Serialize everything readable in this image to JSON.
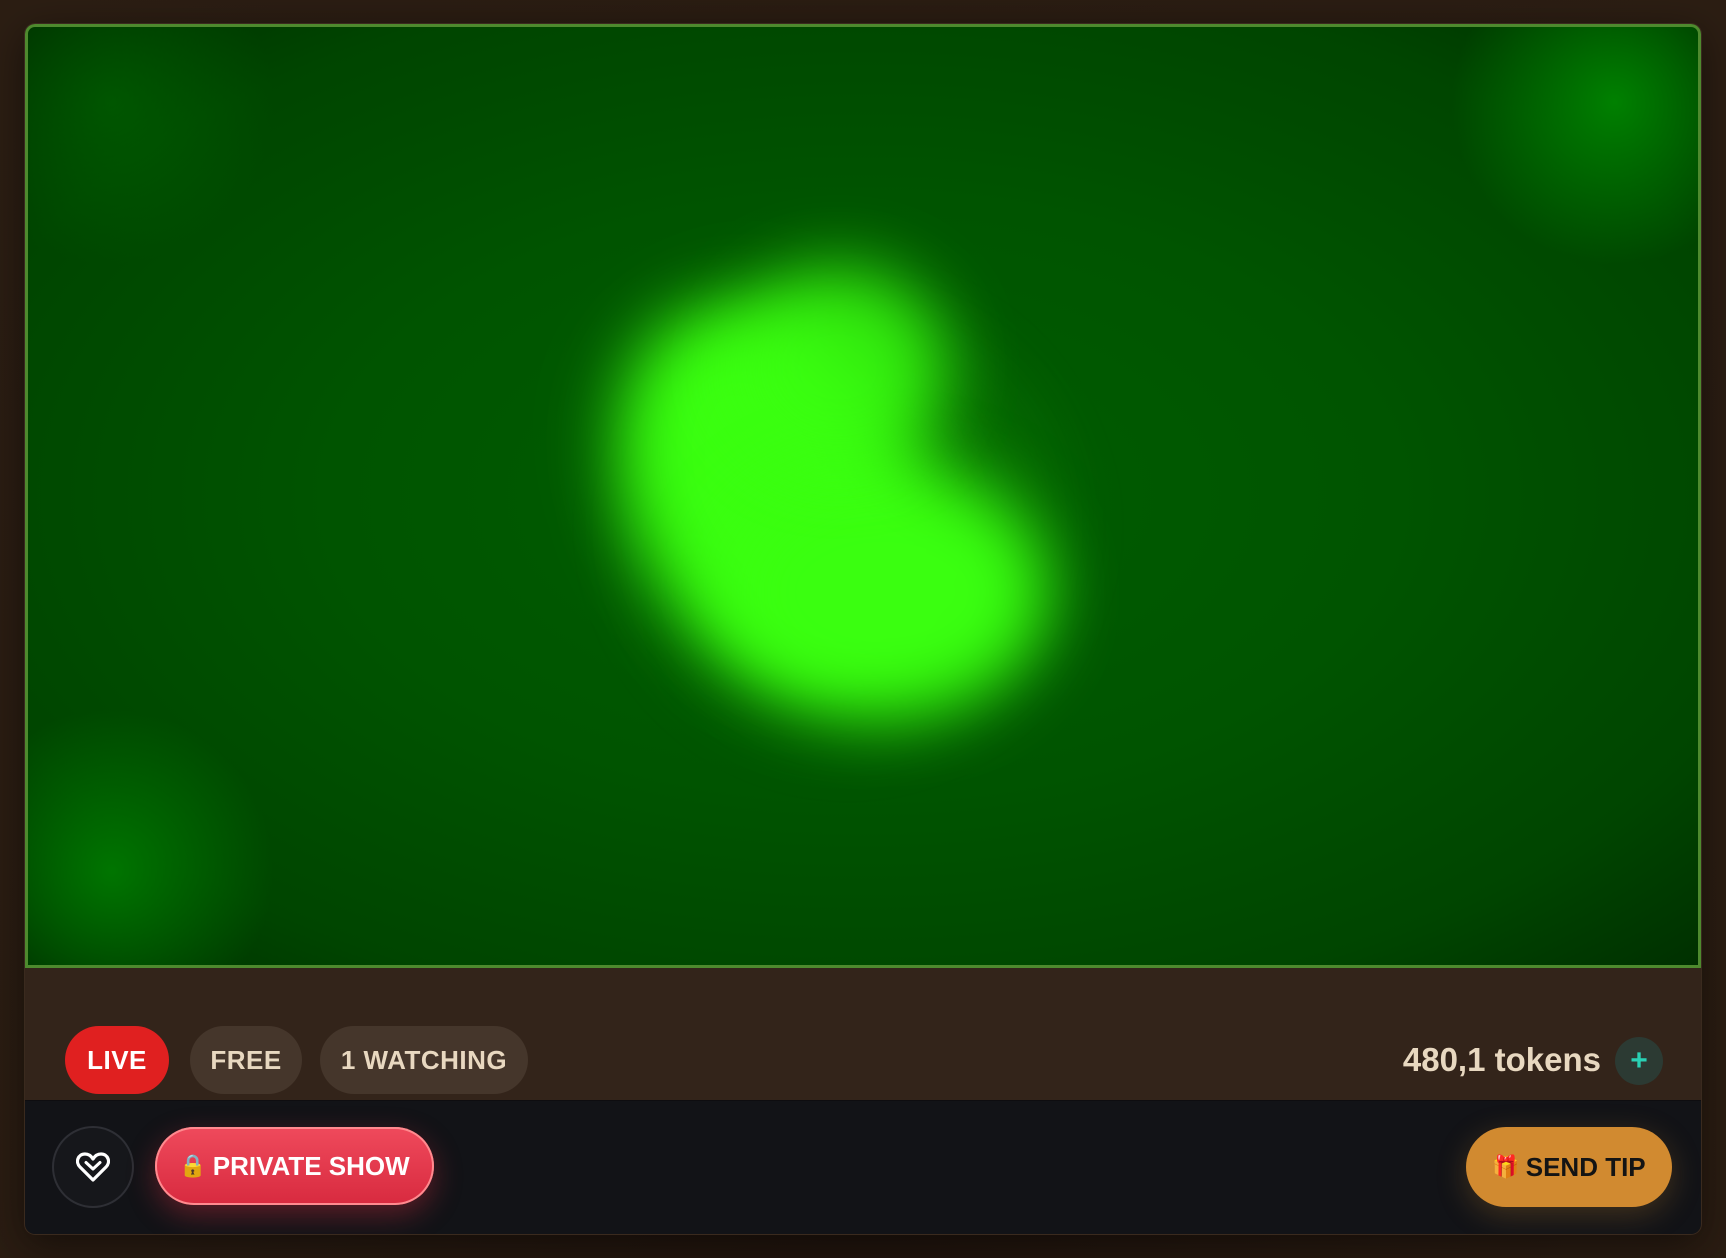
{
  "status": {
    "live_label": "LIVE",
    "price_label": "FREE",
    "viewers_label": "1 WATCHING"
  },
  "wallet": {
    "balance_label": "480,1 tokens",
    "add_label": "+"
  },
  "actions": {
    "private_show_icon": "🔒",
    "private_show_label": "PRIVATE SHOW",
    "send_tip_icon": "🎁",
    "send_tip_label": "SEND TIP"
  },
  "icons": {
    "favorite": "heart-icon",
    "private_show": "lock-icon",
    "send_tip": "gift-icon",
    "add_tokens": "plus-icon"
  },
  "colors": {
    "live_badge": "#e02020",
    "private_show": "#e23a4e",
    "send_tip": "#d18a30",
    "add_tokens": "#2ad0b4",
    "video_glow": "#3aff10"
  }
}
